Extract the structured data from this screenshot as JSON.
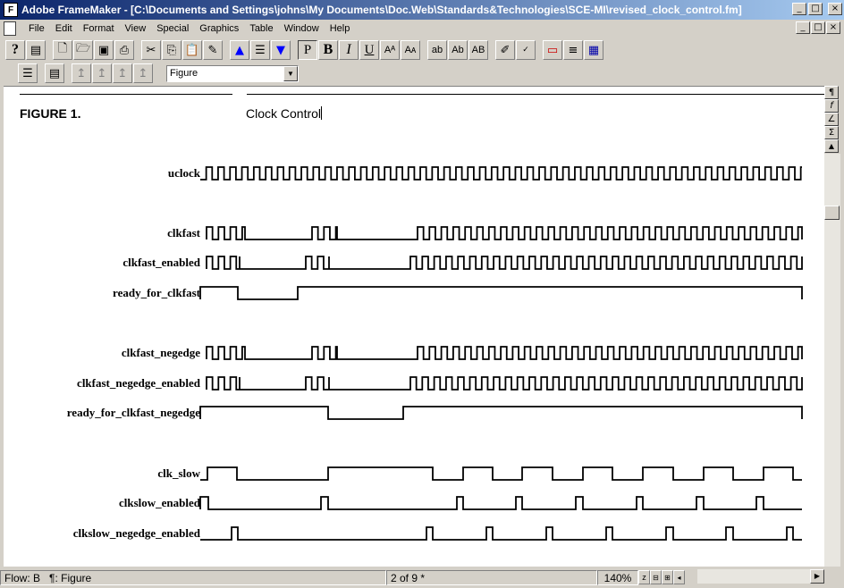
{
  "window": {
    "title": "Adobe FrameMaker - [C:\\Documents and Settings\\johns\\My Documents\\Doc.Web\\Standards&Technologies\\SCE-MI\\revised_clock_control.fm]",
    "minimize": "_",
    "restore": "□",
    "close": "×"
  },
  "menu": [
    "File",
    "Edit",
    "Format",
    "View",
    "Special",
    "Graphics",
    "Table",
    "Window",
    "Help"
  ],
  "toolbar": {
    "help": "?",
    "paragraph_p": "P",
    "bold": "B",
    "italic": "I",
    "underline": "U",
    "lower_ab": "ab",
    "mixed_ab": "Ab",
    "upper_ab": "AB"
  },
  "format_select": {
    "value": "Figure"
  },
  "document": {
    "figure_number": "FIGURE 1.",
    "figure_title": "Clock Control",
    "signals": [
      "uclock",
      "clkfast",
      "clkfast_enabled",
      "ready_for_clkfast",
      "clkfast_negedge",
      "clkfast_negedge_enabled",
      "ready_for_clkfast_negedge",
      "clk_slow",
      "clkslow_enabled",
      "clkslow_negedge_enabled"
    ]
  },
  "side_palette": [
    "¶",
    "f",
    "∠",
    "Σ",
    "▲"
  ],
  "status": {
    "flow": "Flow: B",
    "tag": "¶: Figure",
    "page": "2 of 9 *",
    "zoom": "140%"
  },
  "icons": [
    "app-icon",
    "doc-icon",
    "new-icon",
    "open-icon",
    "save-icon",
    "print-icon",
    "cut-icon",
    "copy-icon",
    "paste-icon",
    "paint-icon",
    "arrow-up-icon",
    "arrow-down-icon",
    "spell-icon",
    "table-icon"
  ]
}
